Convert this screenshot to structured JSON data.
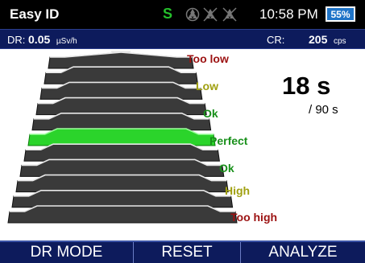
{
  "topbar": {
    "title": "Easy ID",
    "status_letter": "S",
    "status_icons": [
      "radiation-icon",
      "radiation-crossed-icon",
      "radiation-crossed-icon"
    ],
    "time": "10:58 PM",
    "battery": "55%"
  },
  "rates": {
    "dr_label": "DR:",
    "dr_value": "0.05",
    "dr_unit": "µSv/h",
    "cr_label": "CR:",
    "cr_value": "205",
    "cr_unit": "cps"
  },
  "indicator": {
    "labels": [
      "Too low",
      "Low",
      "Ok",
      "Perfect",
      "Ok",
      "High",
      "Too high"
    ],
    "label_colors": [
      "#9c1212",
      "#a0a010",
      "#18901a",
      "#18901a",
      "#18901a",
      "#a0a010",
      "#9c1212"
    ],
    "active_label": "Perfect",
    "active_color": "#2bd42b"
  },
  "timer": {
    "elapsed": "18 s",
    "total": "/ 90 s"
  },
  "softkeys": [
    "DR MODE",
    "RESET",
    "ANALYZE"
  ],
  "colors": {
    "header_blue": "#0d1b5c",
    "status_green": "#25c02c",
    "battery_blue": "#1f74c8"
  }
}
